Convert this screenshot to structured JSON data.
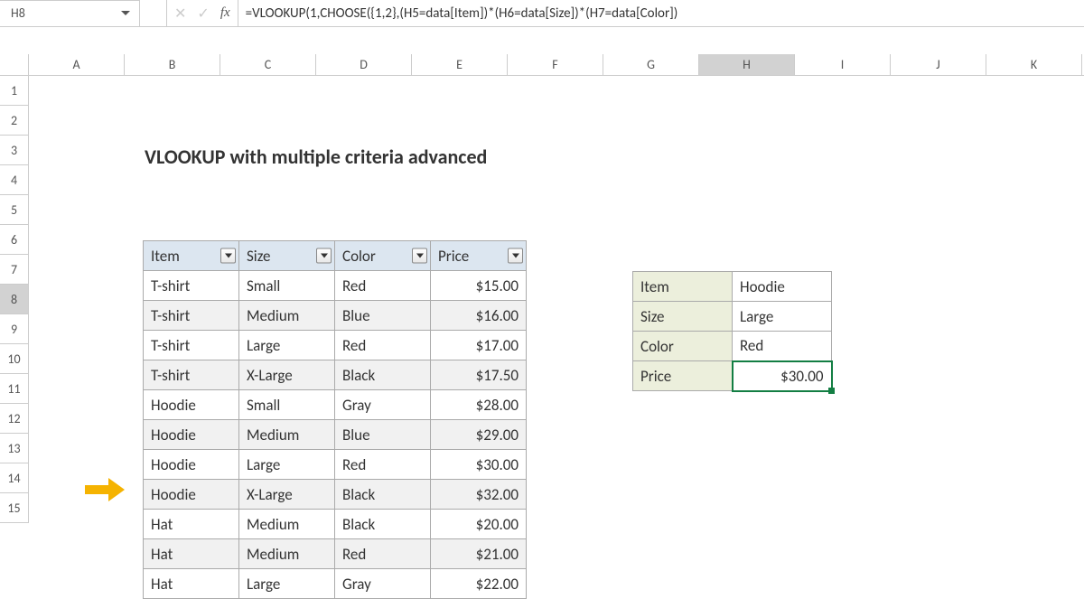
{
  "nameBox": "H8",
  "formula": "=VLOOKUP(1,CHOOSE({1,2},(H5=data[Item])*(H6=data[Size])*(H7=data[Color])",
  "title": "VLOOKUP with multiple criteria advanced",
  "columns": [
    "A",
    "B",
    "C",
    "D",
    "E",
    "F",
    "G",
    "H",
    "I",
    "J",
    "K"
  ],
  "rows": [
    "1",
    "2",
    "3",
    "4",
    "5",
    "6",
    "7",
    "8",
    "9",
    "10",
    "11",
    "12",
    "13",
    "14",
    "15"
  ],
  "activeCol": "H",
  "activeRow": "8",
  "table": {
    "headers": [
      "Item",
      "Size",
      "Color",
      "Price"
    ],
    "rows": [
      {
        "item": "T-shirt",
        "size": "Small",
        "color": "Red",
        "price": "$15.00"
      },
      {
        "item": "T-shirt",
        "size": "Medium",
        "color": "Blue",
        "price": "$16.00"
      },
      {
        "item": "T-shirt",
        "size": "Large",
        "color": "Red",
        "price": "$17.00"
      },
      {
        "item": "T-shirt",
        "size": "X-Large",
        "color": "Black",
        "price": "$17.50"
      },
      {
        "item": "Hoodie",
        "size": "Small",
        "color": "Gray",
        "price": "$28.00"
      },
      {
        "item": "Hoodie",
        "size": "Medium",
        "color": "Blue",
        "price": "$29.00"
      },
      {
        "item": "Hoodie",
        "size": "Large",
        "color": "Red",
        "price": "$30.00"
      },
      {
        "item": "Hoodie",
        "size": "X-Large",
        "color": "Black",
        "price": "$32.00"
      },
      {
        "item": "Hat",
        "size": "Medium",
        "color": "Black",
        "price": "$20.00"
      },
      {
        "item": "Hat",
        "size": "Medium",
        "color": "Red",
        "price": "$21.00"
      },
      {
        "item": "Hat",
        "size": "Large",
        "color": "Gray",
        "price": "$22.00"
      }
    ]
  },
  "lookup": {
    "rows": [
      {
        "label": "Item",
        "value": "Hoodie"
      },
      {
        "label": "Size",
        "value": "Large"
      },
      {
        "label": "Color",
        "value": "Red"
      },
      {
        "label": "Price",
        "value": "$30.00"
      }
    ]
  },
  "highlightRow": 6
}
